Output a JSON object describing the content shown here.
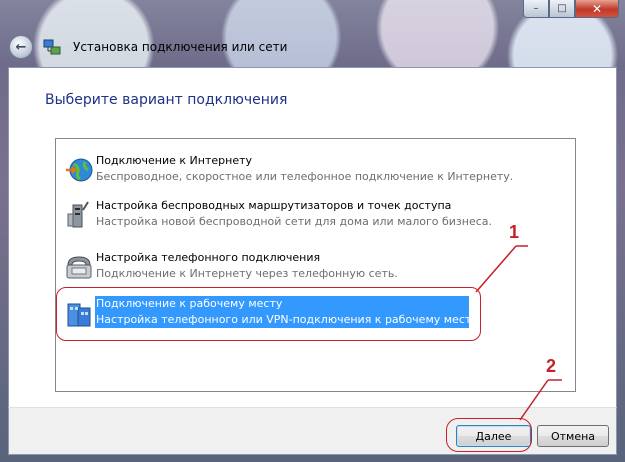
{
  "window": {
    "title": "Установка подключения или сети",
    "caption_buttons": {
      "minimize": "–",
      "maximize": "□",
      "close": "✕"
    },
    "back_glyph": "←"
  },
  "page": {
    "heading": "Выберите вариант подключения"
  },
  "options": [
    {
      "icon": "globe-internet-icon",
      "title": "Подключение к Интернету",
      "desc": "Беспроводное, скоростное или телефонное подключение к Интернету.",
      "selected": false
    },
    {
      "icon": "wireless-router-icon",
      "title": "Настройка беспроводных маршрутизаторов и точек доступа",
      "desc": "Настройка новой беспроводной сети для дома или малого бизнеса.",
      "selected": false
    },
    {
      "icon": "telephone-modem-icon",
      "title": "Настройка телефонного подключения",
      "desc": "Подключение к Интернету через телефонную сеть.",
      "selected": false
    },
    {
      "icon": "workplace-buildings-icon",
      "title": "Подключение к рабочему месту",
      "desc": "Настройка телефонного или VPN-подключения к рабочему месту.",
      "selected": true
    }
  ],
  "footer": {
    "next_label": "Далее",
    "cancel_label": "Отмена"
  },
  "annotations": {
    "mark1": "1",
    "mark2": "2",
    "color": "#c8202a"
  },
  "colors": {
    "selection": "#3399ff",
    "heading": "#1e3287"
  }
}
